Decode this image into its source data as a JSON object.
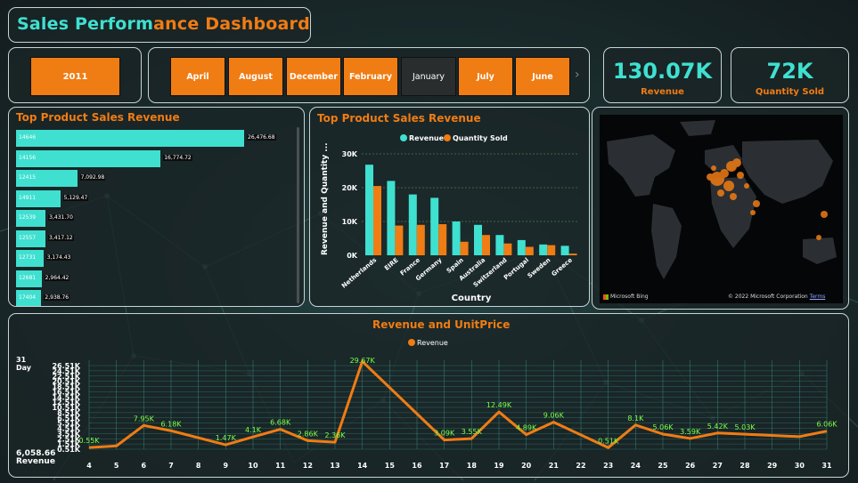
{
  "title": {
    "part1": "Sales Perform",
    "part2": "ance Dashboard"
  },
  "year": "2011",
  "months": [
    "April",
    "August",
    "December",
    "February",
    "January",
    "July",
    "June"
  ],
  "selected_month": "January",
  "kpis": [
    {
      "value": "130.07K",
      "label": "Revenue"
    },
    {
      "value": "72K",
      "label": "Quantity Sold"
    }
  ],
  "colors": {
    "teal": "#3fe0d0",
    "orange": "#f07c14"
  },
  "hbar": {
    "title": "Top Product Sales Revenue",
    "rows": [
      {
        "cat": "14646",
        "value": 26476.68,
        "label": "26,476.68"
      },
      {
        "cat": "14156",
        "value": 16774.72,
        "label": "16,774.72"
      },
      {
        "cat": "12415",
        "value": 7092.98,
        "label": "7,092.98"
      },
      {
        "cat": "14911",
        "value": 5129.47,
        "label": "5,129.47"
      },
      {
        "cat": "12539",
        "value": 3431.7,
        "label": "3,431.70"
      },
      {
        "cat": "12557",
        "value": 3417.12,
        "label": "3,417.12"
      },
      {
        "cat": "12731",
        "value": 3174.43,
        "label": "3,174.43"
      },
      {
        "cat": "12681",
        "value": 2964.42,
        "label": "2,964.42"
      },
      {
        "cat": "17404",
        "value": 2938.76,
        "label": "2,938.76"
      }
    ]
  },
  "chart_data": [
    {
      "type": "bar",
      "title": "Top Product Sales Revenue",
      "xlabel": "Country",
      "ylabel": "Revenue and Quantity ...",
      "categories": [
        "Netherlands",
        "EIRE",
        "France",
        "Germany",
        "Spain",
        "Australia",
        "Switzerland",
        "Portugal",
        "Sweden",
        "Greece"
      ],
      "series": [
        {
          "name": "Revenue",
          "values": [
            26800,
            22000,
            18000,
            17000,
            10000,
            9000,
            6000,
            4500,
            3200,
            2800
          ]
        },
        {
          "name": "Quantity Sold",
          "values": [
            20500,
            8800,
            9000,
            9200,
            4000,
            6000,
            3500,
            2500,
            3000,
            500
          ]
        }
      ],
      "yticks": [
        "0K",
        "10K",
        "20K",
        "30K"
      ],
      "ylim": [
        0,
        30000
      ],
      "legend": "top"
    },
    {
      "type": "line",
      "title": "Revenue and UnitPrice",
      "series": [
        {
          "name": "Revenue",
          "color": "#f07c14"
        }
      ],
      "x": [
        4,
        5,
        6,
        7,
        9,
        10,
        11,
        12,
        13,
        14,
        17,
        18,
        19,
        20,
        21,
        23,
        24,
        25,
        26,
        27,
        28,
        30,
        31
      ],
      "values": [
        550,
        1100,
        7950,
        6180,
        1470,
        4100,
        6680,
        2860,
        2360,
        29670,
        3090,
        3550,
        12490,
        4890,
        9060,
        510,
        8100,
        5060,
        3590,
        5420,
        5030,
        4200,
        6058.66
      ],
      "point_labels": [
        "0.55K",
        "",
        "7.95K",
        "6.18K",
        "1.47K",
        "4.1K",
        "6.68K",
        "2.86K",
        "2.36K",
        "29.67K",
        "3.09K",
        "3.55K",
        "12.49K",
        "4.89K",
        "9.06K",
        "0.51K",
        "8.1K",
        "5.06K",
        "3.59K",
        "5.42K",
        "5.03K",
        "",
        "6.06K"
      ],
      "xticks": [
        "4",
        "5",
        "6",
        "7",
        "8",
        "9",
        "10",
        "11",
        "12",
        "13",
        "14",
        "15",
        "16",
        "17",
        "18",
        "19",
        "20",
        "21",
        "22",
        "23",
        "24",
        "25",
        "26",
        "27",
        "28",
        "29",
        "30",
        "31"
      ],
      "yticks": [
        "0.51K",
        "1.51K",
        "2.51K",
        "3.51K",
        "4.51K",
        "5.51K",
        "6.51K",
        "8.51K",
        "10.51K",
        "12.51K",
        "14.51K",
        "16.51K",
        "18.51K",
        "20.51K",
        "22.51K",
        "24.51K",
        "26.51K"
      ],
      "ylim": [
        0,
        30000
      ],
      "slider_top": {
        "value": "31",
        "label": "Day"
      },
      "slider_bottom": {
        "value": "6,058.66",
        "label": "Revenue"
      }
    }
  ],
  "map": {
    "credit_left": "Microsoft Bing",
    "credit_right": "© 2022 Microsoft Corporation",
    "terms": "Terms"
  }
}
